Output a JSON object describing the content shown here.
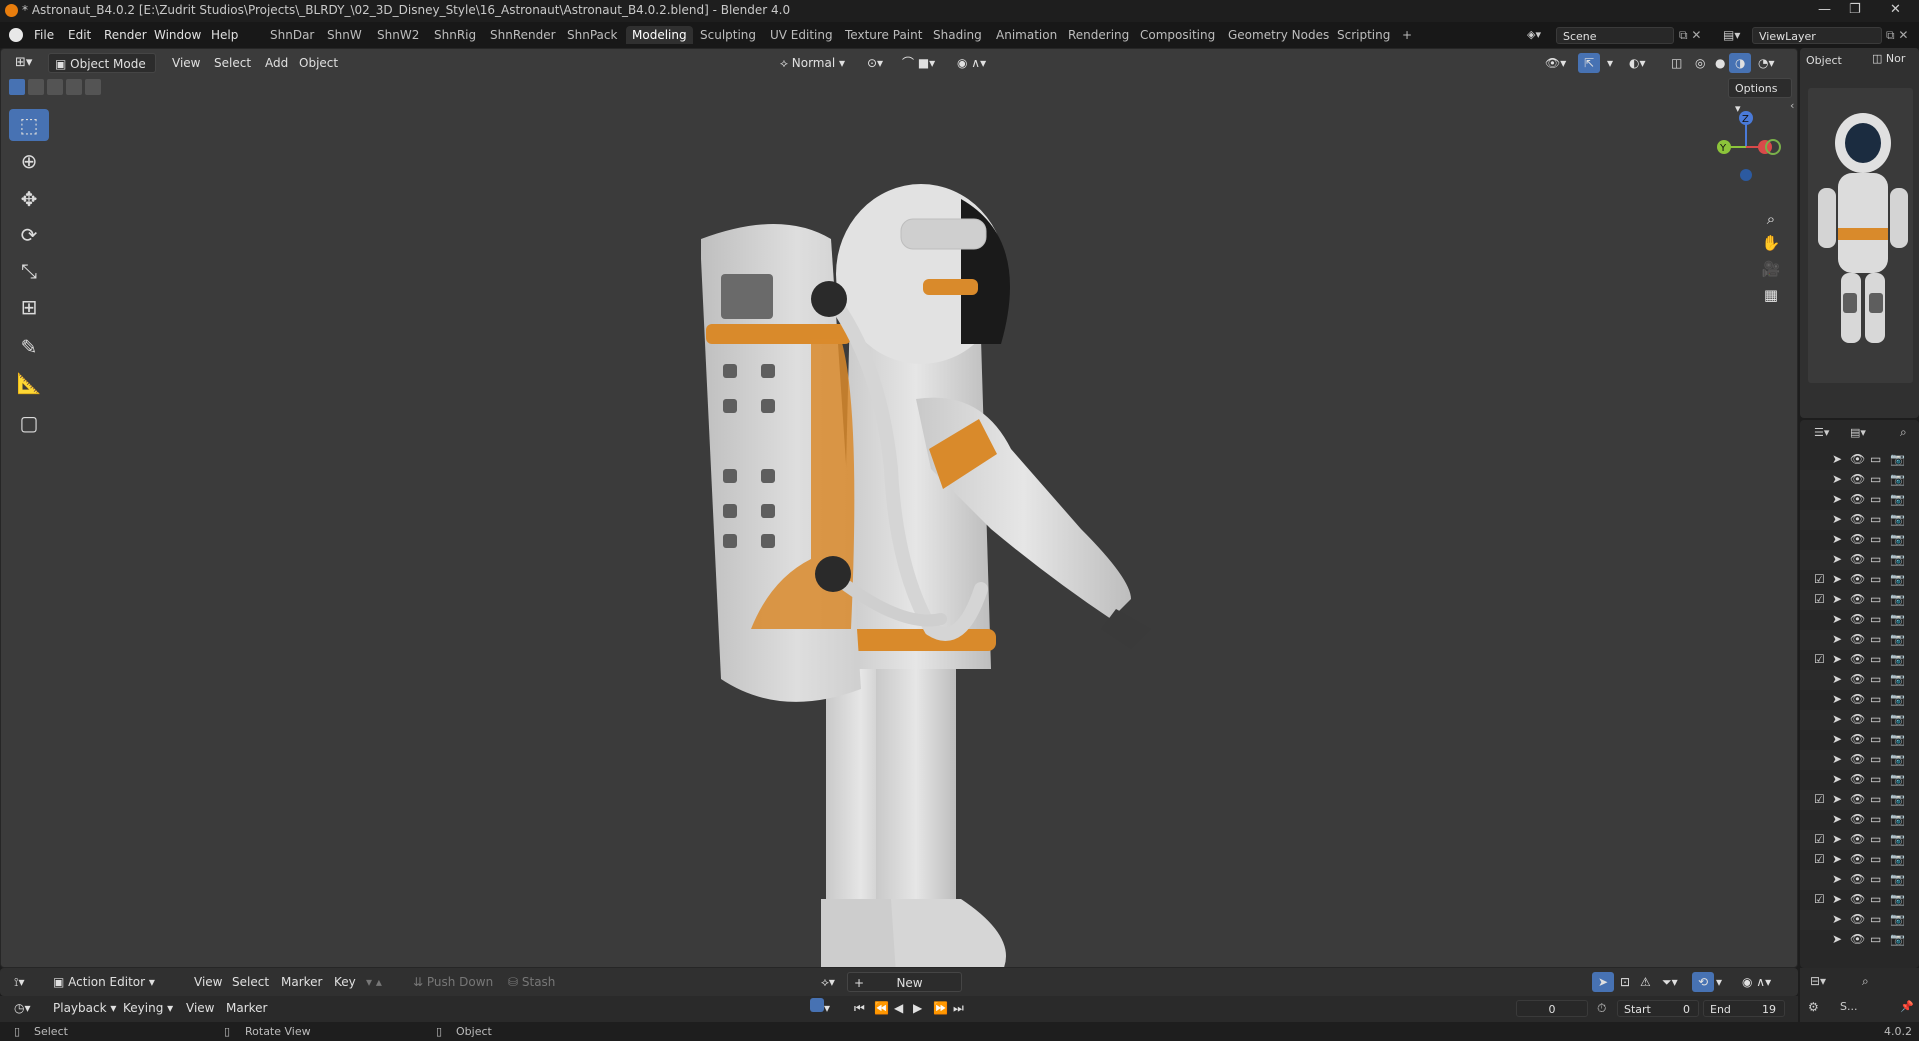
{
  "titlebar": {
    "title": "* Astronaut_B4.0.2 [E:\\Zudrit Studios\\Projects\\_BLRDY_\\02_3D_Disney_Style\\16_Astronaut\\Astronaut_B4.0.2.blend] - Blender 4.0",
    "minimize": "—",
    "restore": "❐",
    "close": "✕"
  },
  "menubar": {
    "menus": [
      "File",
      "Edit",
      "Render",
      "Window",
      "Help"
    ],
    "workspaces": [
      "ShnDar",
      "ShnW",
      "ShnW2",
      "ShnRig",
      "ShnRender",
      "ShnPack",
      "Modeling",
      "Sculpting",
      "UV Editing",
      "Texture Paint",
      "Shading",
      "Animation",
      "Rendering",
      "Compositing",
      "Geometry Nodes",
      "Scripting"
    ],
    "active_workspace": "Modeling",
    "add_workspace": "+",
    "scene": "Scene",
    "view_layer": "ViewLayer"
  },
  "viewport_header": {
    "mode": "Object Mode",
    "menus": [
      "View",
      "Select",
      "Add",
      "Object"
    ],
    "orientation": "Normal",
    "options": "Options"
  },
  "gizmo": {
    "x": "",
    "y": "Y",
    "z": "Z"
  },
  "props_panel": {
    "tabs": [
      "Object",
      "Nor"
    ]
  },
  "outliner": {
    "row_count": 25
  },
  "action_editor": {
    "mode": "Action Editor",
    "menus": [
      "View",
      "Select",
      "Marker",
      "Key"
    ],
    "push_down": "Push Down",
    "stash": "Stash",
    "new": "New"
  },
  "timeline": {
    "menus": [
      "Playback",
      "Keying",
      "View",
      "Marker"
    ],
    "current_frame": "0",
    "start_label": "Start",
    "start": "0",
    "end_label": "End",
    "end": "19"
  },
  "statusbar": {
    "select": "Select",
    "rotate": "Rotate View",
    "object": "Object",
    "version": "4.0.2",
    "scene_short": "S..."
  },
  "colors": {
    "accent": "#4772b3",
    "suit_white": "#dedede",
    "suit_orange": "#d98a2b"
  }
}
